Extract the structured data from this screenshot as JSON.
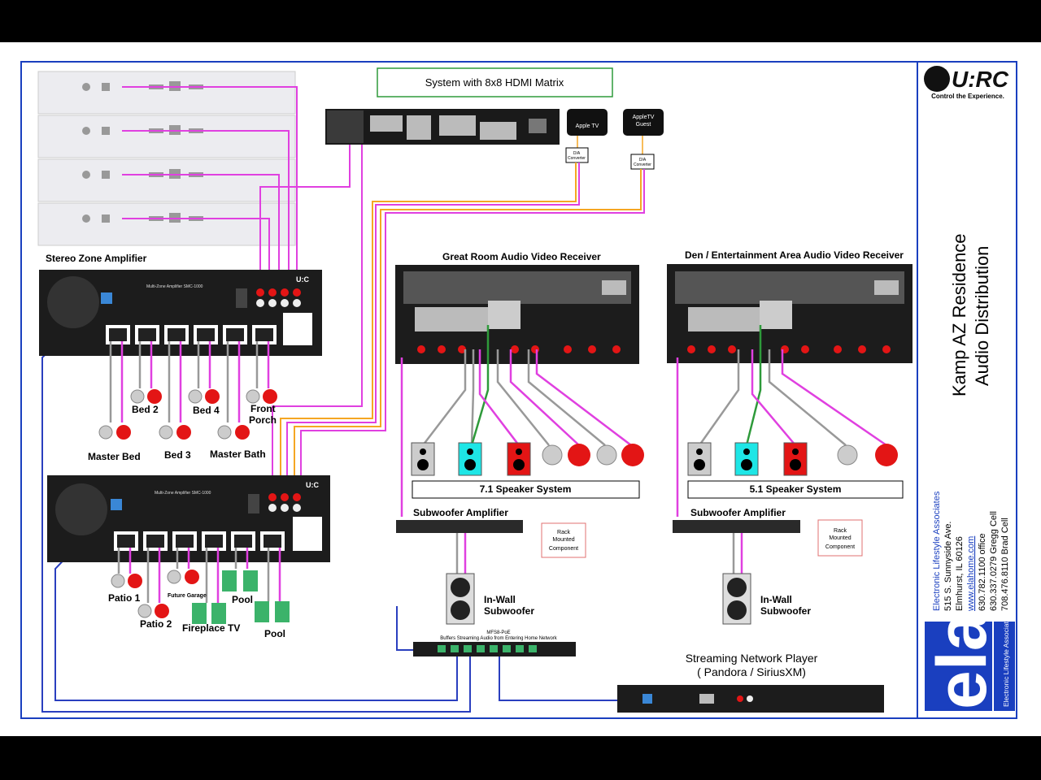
{
  "matrix": {
    "title": "System with 8x8 HDMI Matrix"
  },
  "apple_tv": {
    "label": "Apple TV"
  },
  "apple_tv_guest": {
    "label_line1": "AppleTV",
    "label_line2": "Guest"
  },
  "da_converter": {
    "line1": "D/A",
    "line2": "Converter"
  },
  "stereo_amp": {
    "title": "Stereo Zone Amplifier",
    "brand": "U:C",
    "model_text": "Multi-Zone Amplifier SMC-1000"
  },
  "zones_top": {
    "bed2": "Bed 2",
    "bed4": "Bed 4",
    "front_porch_1": "Front",
    "front_porch_2": "Porch",
    "master_bed": "Master Bed",
    "bed3": "Bed 3",
    "master_bath": "Master Bath"
  },
  "zones_bottom": {
    "patio1": "Patio 1",
    "patio2": "Patio 2",
    "future_garage": "Future Garage",
    "fireplace_tv": "Fireplace TV",
    "pool_a": "Pool",
    "pool_b": "Pool"
  },
  "great_room": {
    "title": "Great Room Audio Video Receiver",
    "speaker_system": "7.1 Speaker System",
    "sub_amp": "Subwoofer Amplifier",
    "rack_1": "Rack",
    "rack_2": "Mounted",
    "rack_3": "Component",
    "inwall_1": "In-Wall",
    "inwall_2": "Subwoofer"
  },
  "den": {
    "title": "Den / Entertainment  Area Audio Video Receiver",
    "speaker_system": "5.1 Speaker System",
    "sub_amp": "Subwoofer Amplifier",
    "rack_1": "Rack",
    "rack_2": "Mounted",
    "rack_3": "Component",
    "inwall_1": "In-Wall",
    "inwall_2": "Subwoofer"
  },
  "switch": {
    "model": "MFS8-PoE",
    "caption": "Buffers Streaming Audio from Entering Home Network"
  },
  "streamer": {
    "line1": "Streaming Network Player",
    "line2": "( Pandora / SiriusXM)"
  },
  "title_block": {
    "urc_logo": "U:RC",
    "tagline": "Control the Experience.",
    "project_line1": "Kamp AZ Residence",
    "project_line2": "Audio Distribution",
    "company": "Electronic Lifestyle Associates",
    "address1": "515 S. Sunnyside Ave.",
    "address2": "Elmhurst, IL 60126",
    "website": "www.elahome.com",
    "phone1": "630.782.1100 office",
    "phone2": "630.337.0279 Gregg Cell",
    "phone3": "708.476.8110 Brad Cell",
    "ela_logo": "ela",
    "ela_small": "Electronic Lifestyle Associates"
  },
  "colors": {
    "hdmi_wire": "#e040e0",
    "green_wire": "#2e9a3a",
    "network_wire": "#2a3fbf",
    "analog_wire": "#f5a623",
    "border": "#1a3fbf",
    "speaker_red": "#e31515",
    "speaker_cyan": "#1ee6e6",
    "terminal_green": "#3bb36a"
  }
}
